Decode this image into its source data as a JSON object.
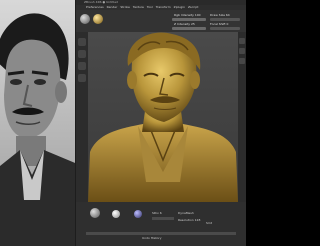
{
  "window": {
    "title": "ZBrush 4R6 ● Untitled"
  },
  "menu": [
    "Preferences",
    "Render",
    "Stroke",
    "Texture",
    "Tool",
    "Transform",
    "Zplugin",
    "Zscript"
  ],
  "toolbar": {
    "rgb_intensity_label": "Rgb Intensity 100",
    "z_intensity_label": "Z Intensity 25",
    "draw_size_label": "Draw Size 64",
    "focal_shift_label": "Focal Shift 0"
  },
  "bottom": {
    "sdiv_label": "SDiv 6",
    "smt_label": "Smt",
    "dynamesh_label": "DynaMesh",
    "resolution_label": "Resolution 128",
    "undo_label": "Undo History"
  },
  "colors": {
    "bronze": "#b8953a",
    "bronze_dark": "#6b4f16",
    "app_bg": "#3a3a3a"
  },
  "icons": [
    "sphere-brush-icon",
    "material-icon",
    "alpha-icon",
    "stroke-icon"
  ]
}
